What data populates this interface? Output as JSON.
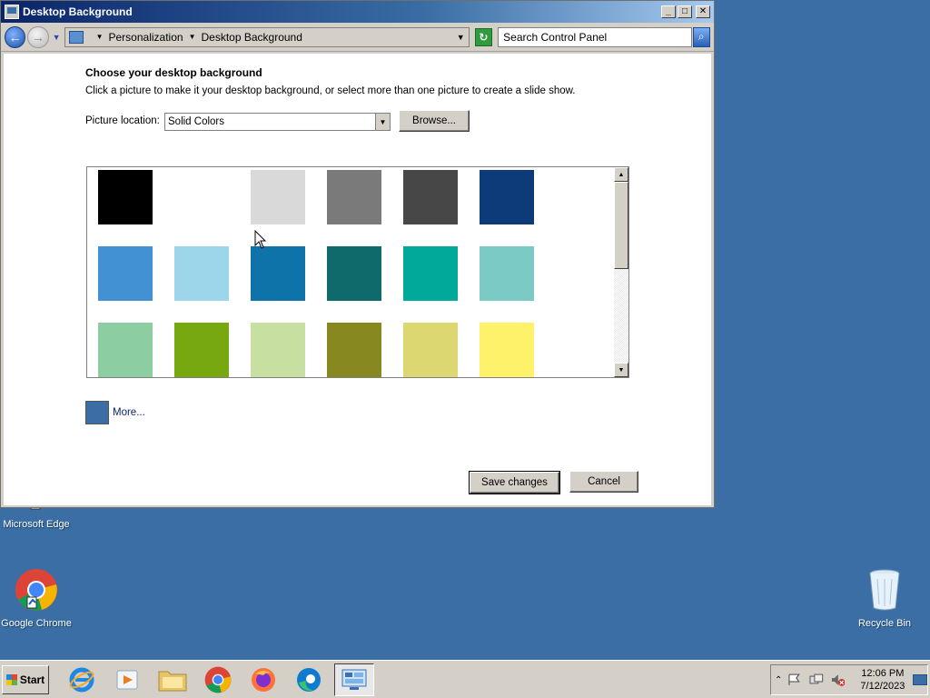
{
  "window": {
    "title": "Desktop Background",
    "minimize_icon": "minimize-icon",
    "maximize_icon": "maximize-icon",
    "close_icon": "close-icon"
  },
  "address": {
    "crumb1": "Personalization",
    "crumb2": "Desktop Background",
    "search_placeholder": "Search Control Panel"
  },
  "main": {
    "heading": "Choose your desktop background",
    "subtext": "Click a picture to make it your desktop background, or select more than one picture to create a slide show.",
    "location_label": "Picture location:",
    "location_value": "Solid Colors",
    "browse_label": "Browse...",
    "more_label": "More...",
    "save_label": "Save changes",
    "cancel_label": "Cancel"
  },
  "colors": {
    "desktop": "#3a6ea5",
    "more_swatch": "#3a6ea5"
  },
  "swatches": [
    "#000000",
    "#ffffff",
    "#d9d9d9",
    "#7a7a7a",
    "#474747",
    "#0d3a78",
    "#4292d3",
    "#9dd6ea",
    "#0d73a8",
    "#0f6b6b",
    "#00a99a",
    "#7ccac5",
    "#8ccea1",
    "#77a80f",
    "#c7dfa0",
    "#888820",
    "#dcd770",
    "#fff26b"
  ],
  "desktop_icons": {
    "edge": "Microsoft Edge",
    "chrome": "Google Chrome",
    "recycle": "Recycle Bin"
  },
  "taskbar": {
    "start_label": "Start",
    "apps": [
      "internet-explorer-icon",
      "media-player-icon",
      "file-explorer-icon",
      "chrome-icon",
      "firefox-icon",
      "edge-icon",
      "control-panel-icon"
    ],
    "time": "12:06 PM",
    "date": "7/12/2023"
  }
}
